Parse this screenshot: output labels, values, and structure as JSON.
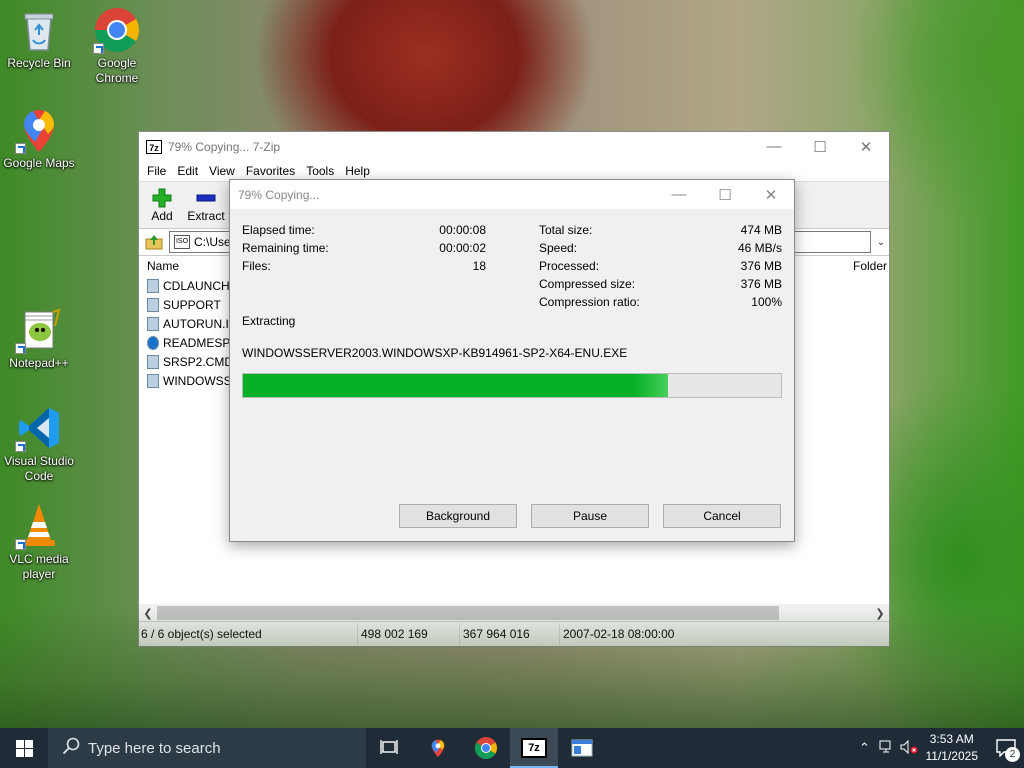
{
  "desktop": {
    "icons": [
      {
        "label_line1": "Recycle Bin",
        "label_line2": "",
        "icon": "recycle-bin-icon"
      },
      {
        "label_line1": "Google",
        "label_line2": "Chrome",
        "icon": "chrome-icon"
      },
      {
        "label_line1": "Google Maps",
        "label_line2": "",
        "icon": "maps-icon"
      },
      {
        "label_line1": "Notepad++",
        "label_line2": "",
        "icon": "notepadpp-icon"
      },
      {
        "label_line1": "Visual Studio",
        "label_line2": "Code",
        "icon": "vscode-icon"
      },
      {
        "label_line1": "VLC media",
        "label_line2": "player",
        "icon": "vlc-icon"
      }
    ]
  },
  "main_window": {
    "title": "79% Copying... 7-Zip",
    "app_icon_text": "7z",
    "controls": {
      "minimize": "—",
      "maximize": "☐",
      "close": "✕"
    },
    "menu": [
      "File",
      "Edit",
      "View",
      "Favorites",
      "Tools",
      "Help"
    ],
    "toolbar": {
      "add_label": "Add",
      "extract_label": "Extract"
    },
    "address": "C:\\Use",
    "columns": {
      "name": "Name",
      "folder": "Folder"
    },
    "files": [
      {
        "name": "CDLAUNCH",
        "icon": "file"
      },
      {
        "name": "SUPPORT",
        "icon": "file"
      },
      {
        "name": "AUTORUN.IN",
        "icon": "file"
      },
      {
        "name": "READMESP.H",
        "icon": "ie"
      },
      {
        "name": "SRSP2.CMD",
        "icon": "file"
      },
      {
        "name": "WINDOWSSE",
        "icon": "file"
      }
    ],
    "status": {
      "selected": "6 / 6 object(s) selected",
      "size": "498 002 169",
      "packed": "367 964 016",
      "modified": "2007-02-18 08:00:00"
    }
  },
  "dialog": {
    "title": "79% Copying...",
    "left_stats": [
      {
        "label": "Elapsed time:",
        "value": "00:00:08"
      },
      {
        "label": "Remaining time:",
        "value": "00:00:02"
      },
      {
        "label": "Files:",
        "value": "18"
      }
    ],
    "right_stats": [
      {
        "label": "Total size:",
        "value": "474 MB"
      },
      {
        "label": "Speed:",
        "value": "46 MB/s"
      },
      {
        "label": "Processed:",
        "value": "376 MB"
      },
      {
        "label": "Compressed size:",
        "value": "376 MB"
      },
      {
        "label": "Compression ratio:",
        "value": "100%"
      }
    ],
    "operation": "Extracting",
    "current_file": "WINDOWSSERVER2003.WINDOWSXP-KB914961-SP2-X64-ENU.EXE",
    "progress_fraction": 0.79,
    "buttons": {
      "background": "Background",
      "pause": "Pause",
      "cancel": "Cancel"
    },
    "progress_color": "#06b025"
  },
  "taskbar": {
    "search_placeholder": "Type here to search",
    "time": "3:53 AM",
    "date": "11/1/2025",
    "notification_count": "2",
    "apps": [
      "task-view-icon",
      "maps-icon",
      "chrome-icon",
      "7zip-icon",
      "explorer-icon"
    ],
    "seven_zip_label": "7z"
  }
}
